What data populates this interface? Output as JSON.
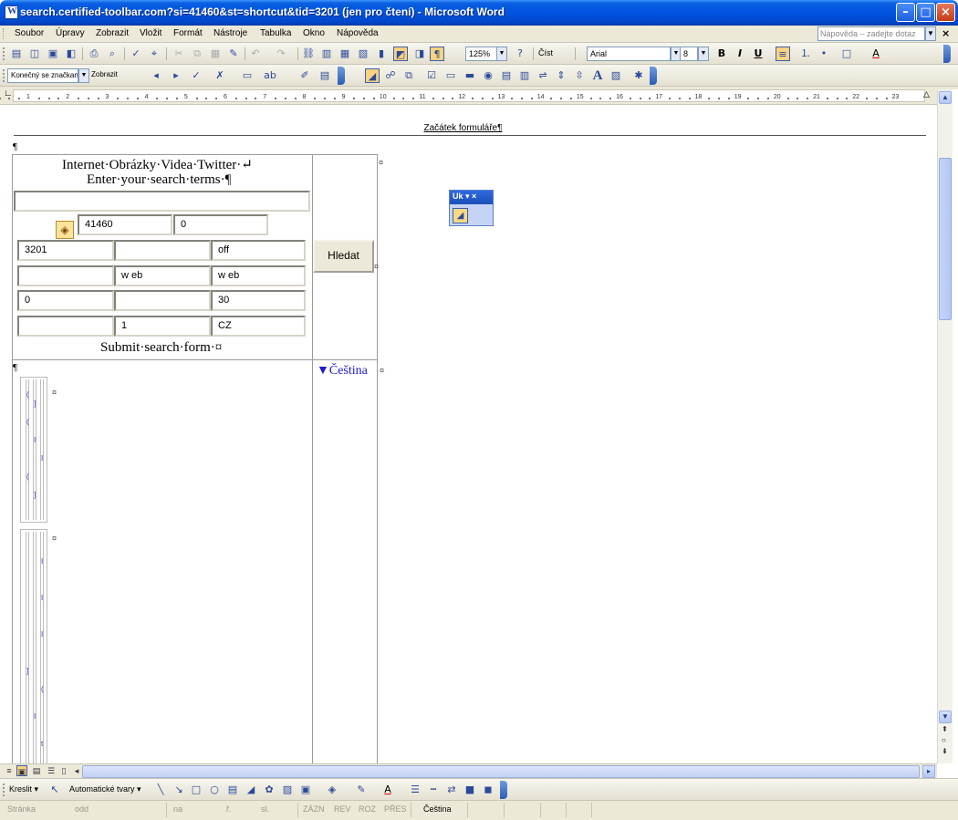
{
  "window": {
    "title": "search.certified-toolbar.com?si=41460&st=shortcut&tid=3201 (jen pro čtení) - Microsoft Word"
  },
  "menu": {
    "items": [
      "Soubor",
      "Úpravy",
      "Zobrazit",
      "Vložit",
      "Formát",
      "Nástroje",
      "Tabulka",
      "Okno",
      "Nápověda"
    ],
    "help_placeholder": "Nápověda – zadejte dotaz"
  },
  "toolbar": {
    "zoom": "125%",
    "read_label": "Číst",
    "font": "Arial",
    "font_size": "8",
    "bold": "B",
    "italic": "I",
    "underline": "U",
    "font_color_glyph": "A",
    "track_changes_mode": "Konečný se značkan",
    "show_label": "Zobrazit",
    "large_a": "A"
  },
  "ruler": {
    "ticks": [
      "1",
      "2",
      "3",
      "4",
      "5",
      "6",
      "7",
      "8",
      "9",
      "10",
      "11",
      "12",
      "13",
      "14",
      "15",
      "16",
      "17",
      "18",
      "19",
      "20",
      "21",
      "22",
      "23"
    ]
  },
  "document": {
    "form_begin": "Začátek formuláře¶",
    "pilcrow": "¶",
    "search_links": "Internet·Obrázky·Videa·Twitter·↵",
    "enter_terms": "Enter·your·search·terms·¶",
    "submit_text": "Submit·search·form·¤",
    "search_button": "Hledat",
    "language": "▼Čeština",
    "cell_end": "¤",
    "fields": {
      "f_41460": "41460",
      "f_0a": "0",
      "f_3201": "3201",
      "f_blank1": "",
      "f_off": "off",
      "f_blank2": "",
      "f_web1": "w eb",
      "f_web2": "w eb",
      "f_0b": "0",
      "f_blank3": "",
      "f_30": "30",
      "f_blank4": "",
      "f_1": "1",
      "f_cz": "CZ"
    }
  },
  "mini_toolbar": {
    "title": "Uk ▾ ×"
  },
  "draw": {
    "draw_label": "Kreslit ▾",
    "autoshapes": "Automatické tvary ▾"
  },
  "status": {
    "page": "Stránka",
    "section": "odd",
    "at": "na",
    "line": "ř.",
    "col": "sl.",
    "rec": "ZÁZN",
    "rev": "REV",
    "ext": "ROZ",
    "ovr": "PŘES",
    "lang": "Čeština"
  }
}
